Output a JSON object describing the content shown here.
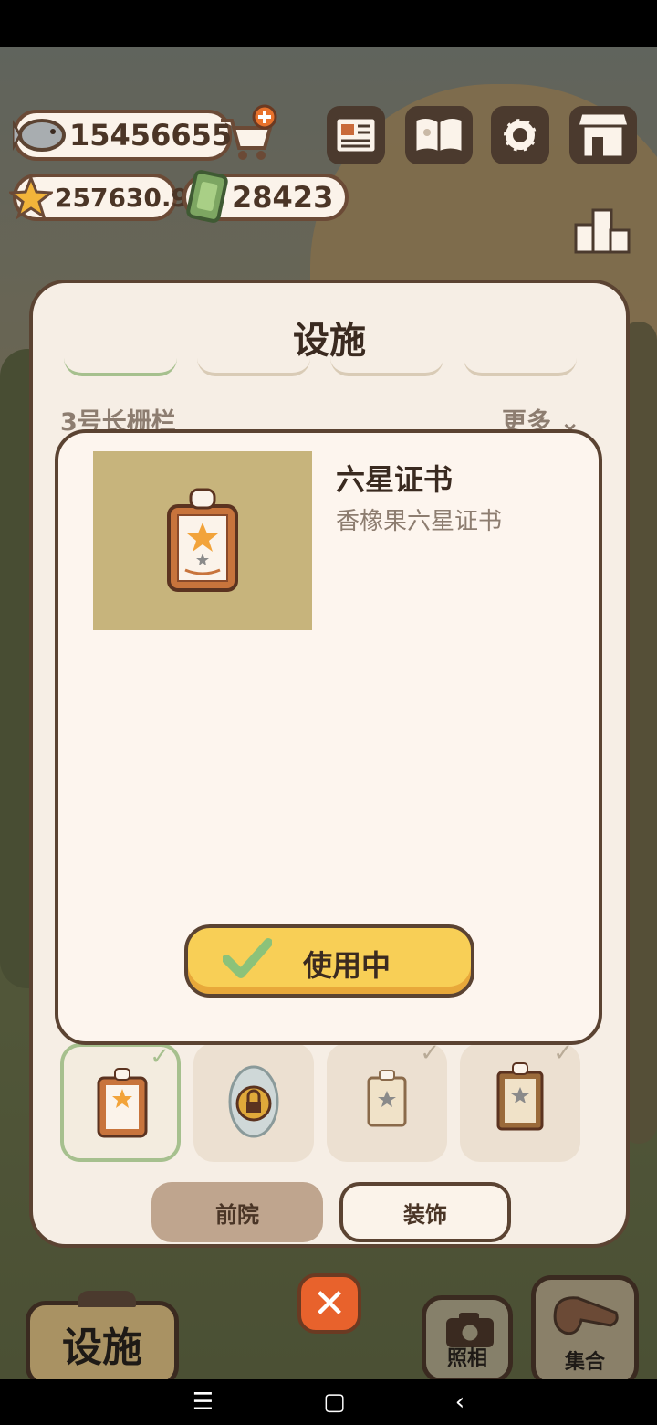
{
  "hud": {
    "fish_count": "15456655",
    "star_count": "257630.9",
    "ticket_count": "28423"
  },
  "panel": {
    "title": "设施",
    "section_label": "3号长栅栏",
    "more_label": "更多"
  },
  "popup": {
    "item_title": "六星证书",
    "item_description": "香橡果六星证书",
    "use_button_label": "使用中"
  },
  "tabs": {
    "yard_label": "前院",
    "decor_label": "装饰"
  },
  "bottom": {
    "facility_label": "设施",
    "photo_label": "照相",
    "gather_label": "集合"
  },
  "icons": [
    "fish-icon",
    "cart-plus-icon",
    "star-icon",
    "ticket-icon",
    "news-icon",
    "book-icon",
    "gear-icon",
    "shop-icon",
    "leaderboard-icon",
    "certificate-icon",
    "lock-icon",
    "check-icon",
    "close-icon",
    "camera-icon",
    "whistle-icon"
  ]
}
